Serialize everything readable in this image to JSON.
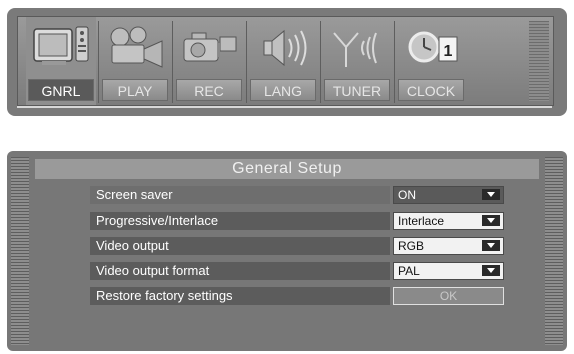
{
  "toolbar": {
    "items": [
      {
        "label": "GNRL",
        "icon": "tv-icon",
        "active": true
      },
      {
        "label": "PLAY",
        "icon": "projector-icon",
        "active": false
      },
      {
        "label": "REC",
        "icon": "camcorder-icon",
        "active": false
      },
      {
        "label": "LANG",
        "icon": "speaker-icon",
        "active": false
      },
      {
        "label": "TUNER",
        "icon": "antenna-icon",
        "active": false
      },
      {
        "label": "CLOCK",
        "icon": "clock-icon",
        "active": false
      }
    ],
    "clock_badge": "1"
  },
  "setup": {
    "title": "General  Setup",
    "rows": [
      {
        "label": "Screen  saver",
        "value": "ON"
      },
      {
        "label": "Progressive/Interlace",
        "value": "Interlace"
      },
      {
        "label": "Video  output",
        "value": "RGB"
      },
      {
        "label": "Video  output  format",
        "value": "PAL"
      },
      {
        "label": "Restore  factory  settings",
        "button": "OK"
      }
    ]
  },
  "colors": {
    "panel": "#7a7a7a",
    "highlight": "#5a5a5a",
    "value_bg": "#f2f2f2"
  }
}
